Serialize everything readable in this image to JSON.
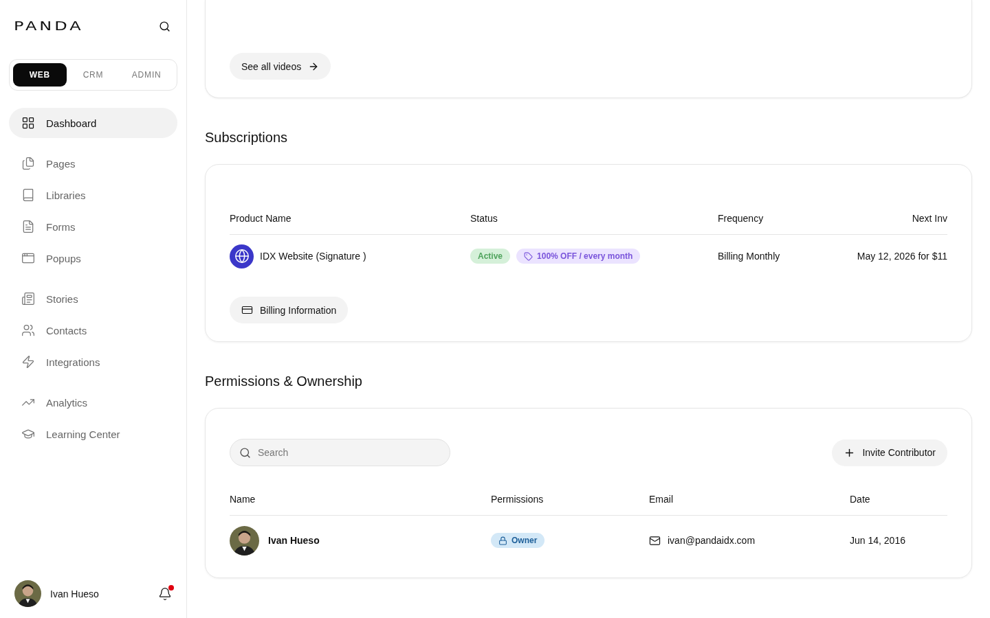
{
  "sidebar": {
    "logo": "PANDA",
    "workspace_tabs": [
      {
        "label": "WEB",
        "selected": true
      },
      {
        "label": "CRM",
        "selected": false
      },
      {
        "label": "ADMIN",
        "selected": false
      }
    ],
    "nav_groups": [
      [
        {
          "label": "Dashboard",
          "selected": true
        }
      ],
      [
        {
          "label": "Pages",
          "selected": false
        },
        {
          "label": "Libraries",
          "selected": false
        },
        {
          "label": "Forms",
          "selected": false
        },
        {
          "label": "Popups",
          "selected": false
        }
      ],
      [
        {
          "label": "Stories",
          "selected": false
        },
        {
          "label": "Contacts",
          "selected": false
        },
        {
          "label": "Integrations",
          "selected": false
        }
      ],
      [
        {
          "label": "Analytics",
          "selected": false
        },
        {
          "label": "Learning Center",
          "selected": false
        }
      ]
    ],
    "user": {
      "name": "Ivan Hueso",
      "has_notification": true
    }
  },
  "videos": {
    "button": "See all videos"
  },
  "subscriptions": {
    "title": "Subscriptions",
    "columns": [
      "Product Name",
      "Status",
      "Frequency",
      "Next Inv"
    ],
    "rows": [
      {
        "product": "IDX Website (Signature )",
        "status": "Active",
        "discount": "100% OFF / every month",
        "frequency": "Billing Monthly",
        "next_invoice": "May 12, 2026 for $11"
      }
    ],
    "button": "Billing Information"
  },
  "permissions": {
    "title": "Permissions & Ownership",
    "search": {
      "placeholder": "Search"
    },
    "invite_button": "Invite Contributor",
    "columns": [
      "Name",
      "Permissions",
      "Email",
      "Date"
    ],
    "rows": [
      {
        "name": "Ivan Hueso",
        "role": "Owner",
        "email": "ivan@pandaidx.com",
        "date": "Jun 14, 2016"
      }
    ]
  }
}
